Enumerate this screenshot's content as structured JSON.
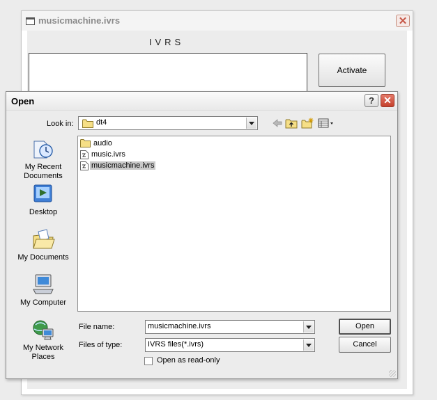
{
  "app": {
    "title": "musicmachine.ivrs",
    "heading": "IVRS",
    "activate_label": "Activate",
    "close_symbol": "✕"
  },
  "dialog": {
    "title": "Open",
    "help_symbol": "?",
    "close_symbol": "✕",
    "look_in_label": "Look in:",
    "look_in_value": "dt4",
    "toolbar": {
      "back_icon": "back-arrow-icon",
      "up_icon": "up-folder-icon",
      "new_folder_icon": "new-folder-icon",
      "views_icon": "views-menu-icon"
    },
    "places": [
      {
        "label": "My Recent Documents",
        "icon": "recent-documents-icon"
      },
      {
        "label": "Desktop",
        "icon": "desktop-icon"
      },
      {
        "label": "My Documents",
        "icon": "my-documents-icon"
      },
      {
        "label": "My Computer",
        "icon": "my-computer-icon"
      },
      {
        "label": "My Network Places",
        "icon": "network-places-icon"
      }
    ],
    "files": [
      {
        "name": "audio",
        "type": "folder",
        "selected": false
      },
      {
        "name": "music.ivrs",
        "type": "file",
        "selected": false
      },
      {
        "name": "musicmachine.ivrs",
        "type": "file",
        "selected": true
      }
    ],
    "file_name_label": "File name:",
    "file_name_value": "musicmachine.ivrs",
    "file_type_label": "Files of type:",
    "file_type_value": "IVRS files(*.ivrs)",
    "open_label": "Open",
    "cancel_label": "Cancel",
    "read_only_label": "Open as read-only",
    "read_only_checked": false
  },
  "colors": {
    "selection": "#c9c9c9",
    "close_red": "#c4402c",
    "dialog_bg": "#ececec"
  }
}
